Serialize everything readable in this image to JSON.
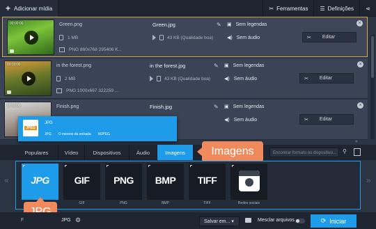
{
  "toolbar": {
    "add_media_label": "Adicionar mídia",
    "tools_label": "Ferramentas",
    "settings_label": "Definições"
  },
  "files": [
    {
      "thumb_time": "00:00:00",
      "source_name": "Green.png",
      "source_size": "1 MB",
      "source_format": "PNG 860x768 295406 K...",
      "output_name": "Green.jpg",
      "output_size": "43 KB (Qualidade boa)",
      "subtitles": "Sem legendas",
      "audio": "Sem áudio",
      "edit_label": "Editar",
      "selected": true
    },
    {
      "thumb_time": "00:00:00",
      "source_name": "in the forest.png",
      "source_size": "2 MB",
      "source_format": "PNG 1000x667 322259 ...",
      "output_name": "in the forest.jpg",
      "output_size": "43 KB (Qualidade boa)",
      "subtitles": "Sem legendas",
      "audio": "Sem áudio",
      "edit_label": "Editar",
      "selected": false
    },
    {
      "thumb_time": "00:00:00",
      "source_name": "Finish.png",
      "source_size": "",
      "source_format": "",
      "output_name": "Finish.jpg",
      "output_size": "",
      "subtitles": "Sem legendas",
      "audio": "Sem áudio",
      "edit_label": "Editar",
      "selected": false
    }
  ],
  "format_popup": {
    "icon_text": "JPEG",
    "title": "JPG",
    "detail_1": "JPG",
    "detail_2": "O mesmo da entrada",
    "detail_3": "MJPEG"
  },
  "tabs": [
    {
      "label": "Populares",
      "active": false
    },
    {
      "label": "Vídeo",
      "active": false
    },
    {
      "label": "Dispositivos",
      "active": false
    },
    {
      "label": "Áudio",
      "active": false
    },
    {
      "label": "Imagens",
      "active": true
    }
  ],
  "search": {
    "placeholder": "Encontrar formato ou dispositivo..."
  },
  "callouts": {
    "images": "Imagens",
    "jpg": "JPG"
  },
  "formats": [
    {
      "logo": "JPG",
      "label": "",
      "active": true
    },
    {
      "logo": "GIF",
      "label": "GIF",
      "active": false
    },
    {
      "logo": "PNG",
      "label": "PNG",
      "active": false
    },
    {
      "logo": "BMP",
      "label": "BMP",
      "active": false
    },
    {
      "logo": "TIFF",
      "label": "TIFF",
      "active": false
    },
    {
      "logo": "",
      "label": "Redes sociais",
      "active": false
    }
  ],
  "bottom": {
    "output_format_label": "Formato de saída:",
    "output_format_value": "JPG",
    "save_to_label": "Salvar em...",
    "merge_label": "Mesclar arquivos",
    "start_label": "Iniciar"
  },
  "colors": {
    "accent": "#1e9be9",
    "callout": "#f08a5d",
    "selected_border": "#d8a94a"
  }
}
